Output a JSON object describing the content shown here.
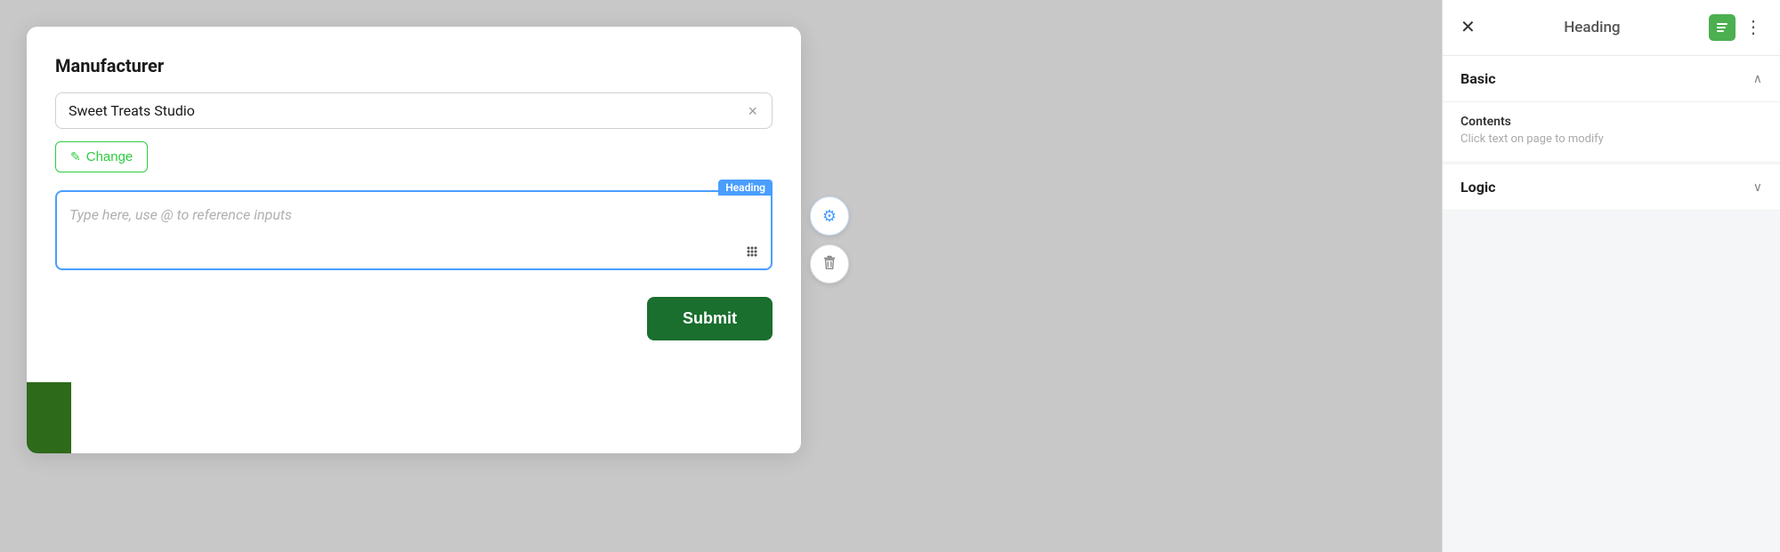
{
  "modal": {
    "title": "Manufacturer",
    "manufacturer_value": "Sweet Treats Studio",
    "clear_btn_label": "×",
    "change_btn_label": "Change",
    "heading_badge": "Heading",
    "textarea_placeholder": "Type here, use @ to reference inputs",
    "submit_label": "Submit"
  },
  "panel": {
    "close_icon": "✕",
    "header_title": "Heading",
    "heading_icon": "≡",
    "more_icon": "⋮",
    "basic_section": {
      "title": "Basic",
      "chevron_up": "∧",
      "contents_label": "Contents",
      "contents_hint": "Click text on page to modify"
    },
    "logic_section": {
      "title": "Logic",
      "chevron_down": "∨"
    }
  },
  "icons": {
    "edit_icon": "✎",
    "gear_icon": "⚙",
    "trash_icon": "🗑",
    "dots_icon": "⠿"
  }
}
